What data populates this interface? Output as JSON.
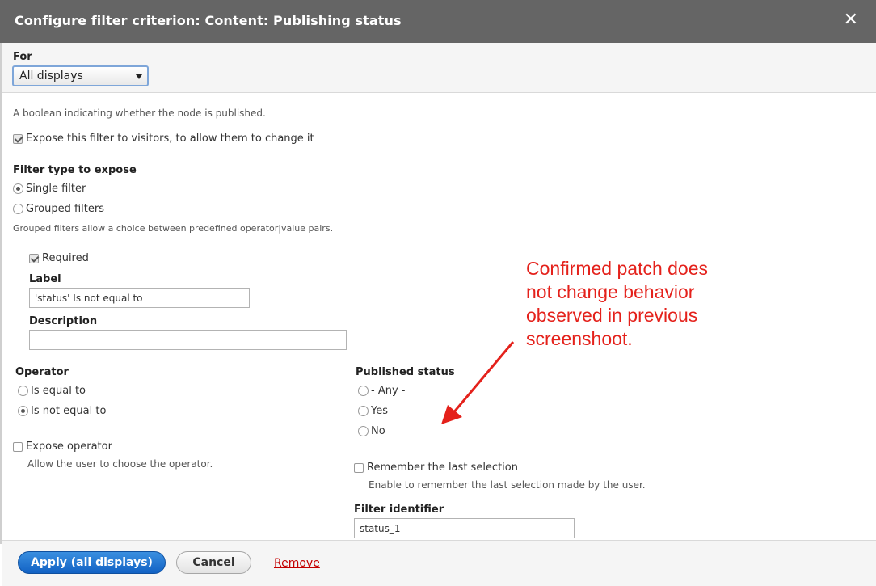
{
  "dialog": {
    "title": "Configure filter criterion: Content: Publishing status",
    "close_glyph": "✕"
  },
  "for_select": {
    "label": "For",
    "value": "All displays"
  },
  "description_text": "A boolean indicating whether the node is published.",
  "expose_checkbox": {
    "label": "Expose this filter to visitors, to allow them to change it",
    "checked": true
  },
  "filter_type": {
    "heading": "Filter type to expose",
    "options": [
      {
        "label": "Single filter",
        "checked": true
      },
      {
        "label": "Grouped filters",
        "checked": false
      }
    ],
    "help": "Grouped filters allow a choice between predefined operator|value pairs."
  },
  "required": {
    "label": "Required",
    "checked": true
  },
  "label_field": {
    "heading": "Label",
    "value": "'status' Is not equal to"
  },
  "description_field": {
    "heading": "Description",
    "value": ""
  },
  "operator": {
    "heading": "Operator",
    "options": [
      {
        "label": "Is equal to",
        "checked": false
      },
      {
        "label": "Is not equal to",
        "checked": true
      }
    ]
  },
  "expose_operator": {
    "label": "Expose operator",
    "checked": false,
    "help": "Allow the user to choose the operator."
  },
  "published_status": {
    "heading": "Published status",
    "options": [
      {
        "label": "- Any -",
        "checked": false
      },
      {
        "label": "Yes",
        "checked": false
      },
      {
        "label": "No",
        "checked": false
      }
    ]
  },
  "remember": {
    "label": "Remember the last selection",
    "checked": false,
    "help": "Enable to remember the last selection made by the user."
  },
  "filter_identifier": {
    "heading": "Filter identifier",
    "value": "status_1"
  },
  "annotation": {
    "lines": [
      "Confirmed patch does",
      "not change behavior",
      "observed in previous",
      "screenshoot."
    ],
    "color": "#e4211b"
  },
  "footer": {
    "apply_label": "Apply (all displays)",
    "cancel_label": "Cancel",
    "remove_label": "Remove"
  }
}
